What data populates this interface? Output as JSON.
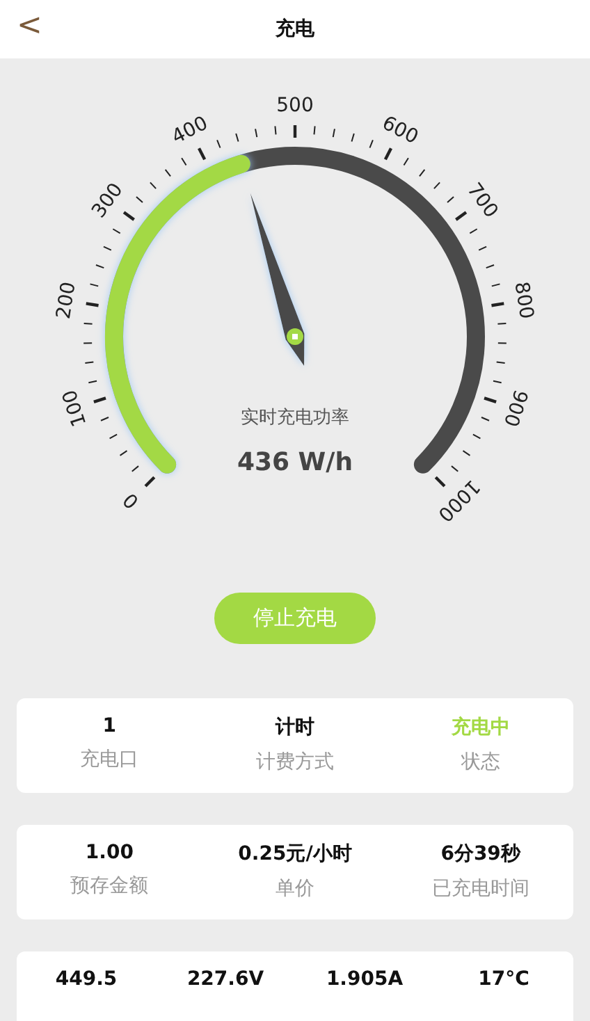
{
  "header": {
    "back_icon": "<",
    "title": "充电"
  },
  "gauge": {
    "caption": "实时充电功率",
    "reading": "436 W/h",
    "scale_labels": [
      "0",
      "100",
      "200",
      "300",
      "400",
      "500",
      "600",
      "700",
      "800",
      "900",
      "1000"
    ]
  },
  "stop_button": "停止充电",
  "cards": [
    {
      "items": [
        {
          "value": "1",
          "label": "充电口",
          "highlighted": false
        },
        {
          "value": "计时",
          "label": "计费方式",
          "highlighted": false
        },
        {
          "value": "充电中",
          "label": "状态",
          "highlighted": true
        }
      ]
    },
    {
      "items": [
        {
          "value": "1.00",
          "label": "预存金额",
          "highlighted": false
        },
        {
          "value": "0.25元/小时",
          "label": "单价",
          "highlighted": false
        },
        {
          "value": "6分39秒",
          "label": "已充电时间",
          "highlighted": false
        }
      ]
    },
    {
      "items": [
        {
          "value": "449.5",
          "highlighted": false
        },
        {
          "value": "227.6V",
          "highlighted": false
        },
        {
          "value": "1.905A",
          "highlighted": false
        },
        {
          "value": "17°C",
          "highlighted": false
        }
      ]
    }
  ]
}
